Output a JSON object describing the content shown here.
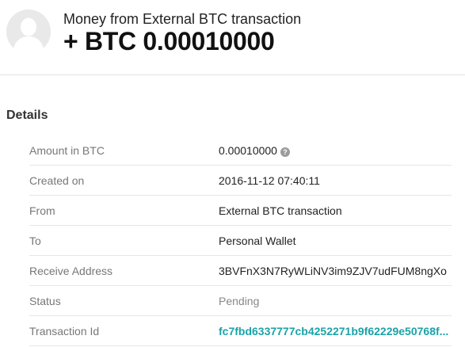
{
  "header": {
    "title": "Money from External BTC transaction",
    "amount": "+ BTC 0.00010000"
  },
  "details": {
    "heading": "Details",
    "help_icon_glyph": "?",
    "rows": [
      {
        "label": "Amount in BTC",
        "value": "0.00010000"
      },
      {
        "label": "Created on",
        "value": "2016-11-12 07:40:11"
      },
      {
        "label": "From",
        "value": "External BTC transaction"
      },
      {
        "label": "To",
        "value": "Personal Wallet"
      },
      {
        "label": "Receive Address",
        "value": "3BVFnX3N7RyWLiNV3im9ZJV7udFUM8ngXo"
      },
      {
        "label": "Status",
        "value": "Pending"
      },
      {
        "label": "Transaction Id",
        "value": "fc7fbd6337777cb4252271b9f62229e50768f..."
      }
    ]
  },
  "icons": {
    "avatar": "user-silhouette-icon",
    "help": "question-circle-icon"
  },
  "colors": {
    "link": "#1aa3a8",
    "pending": "#888888",
    "divider": "#e6e6e6"
  }
}
